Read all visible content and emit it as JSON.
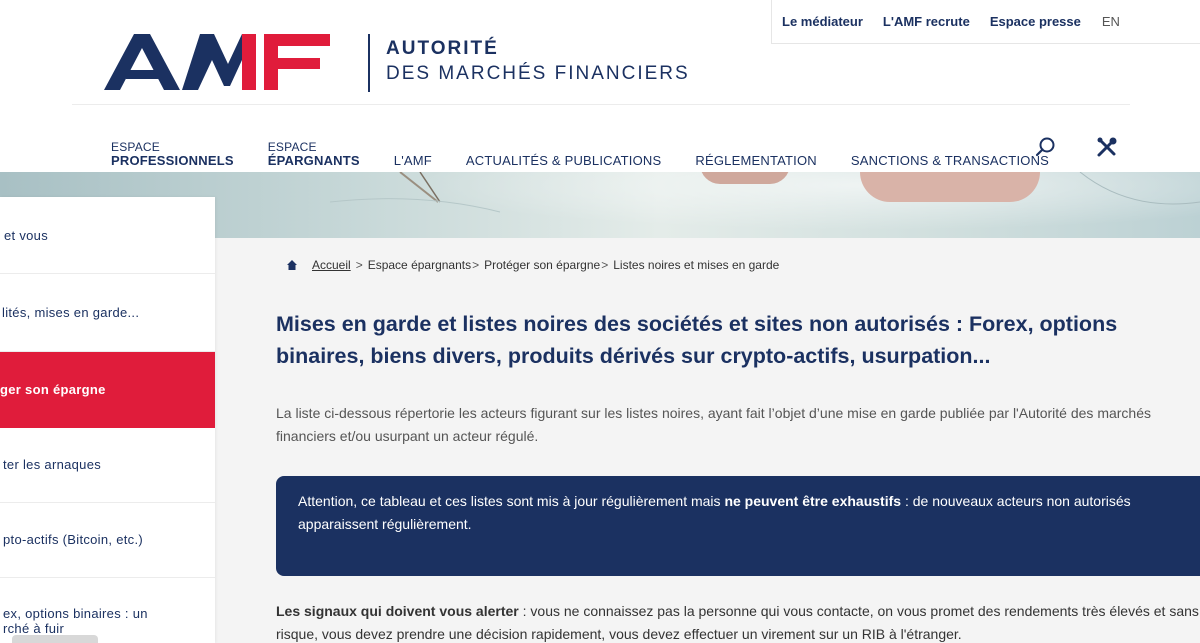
{
  "utility": {
    "mediateur": "Le médiateur",
    "recrute": "L'AMF recrute",
    "presse": "Espace presse",
    "lang": "EN"
  },
  "logo": {
    "line1": "AUTORITÉ",
    "line2": "DES MARCHÉS FINANCIERS",
    "colors": {
      "navy": "#1b3161",
      "red": "#e01c3b"
    }
  },
  "nav": {
    "pro_small": "ESPACE",
    "pro_strong": "PROFESSIONNELS",
    "epar_small": "ESPACE",
    "epar_strong": "ÉPARGNANTS",
    "amf": "L'AMF",
    "actu": "ACTUALITÉS & PUBLICATIONS",
    "regl": "RÉGLEMENTATION",
    "sanctions": "SANCTIONS & TRANSACTIONS",
    "icons": [
      "search-icon",
      "tools-icon"
    ]
  },
  "sidebar": {
    "items": [
      {
        "label": "et vous"
      },
      {
        "label": "lités, mises en garde..."
      },
      {
        "label": "ger son épargne"
      },
      {
        "label": "ter les arnaques"
      },
      {
        "label": "pto-actifs (Bitcoin, etc.)"
      },
      {
        "label": "ex, options binaires : un",
        "label2": "rché à fuir"
      }
    ]
  },
  "breadcrumb": {
    "home": "Accueil",
    "c2": "Espace épargnants",
    "c3": "Protéger son épargne",
    "c4": "Listes noires et mises en garde"
  },
  "main": {
    "title": "Mises en garde et listes noires des sociétés et sites non autorisés : Forex, options binaires, biens divers, produits dérivés sur crypto-actifs, usurpation...",
    "intro": "La liste ci-dessous répertorie les acteurs figurant sur les listes noires, ayant fait l’objet d’une mise en garde publiée par l'Autorité des marchés financiers et/ou usurpant un acteur régulé.",
    "alert_before": "Attention, ce tableau et ces listes sont mis à jour régulièrement mais ",
    "alert_bold": "ne peuvent être exhaustifs",
    "alert_after": " : de nouveaux acteurs non autorisés apparaissent régulièrement.",
    "signals_bold": "Les signaux qui doivent vous alerter",
    "signals_text": " : vous ne connaissez pas la personne qui vous contacte, on vous promet des rendements très élevés et sans risque, vous devez prendre une décision rapidement, vous devez effectuer un virement sur un RIB à l'étranger."
  }
}
